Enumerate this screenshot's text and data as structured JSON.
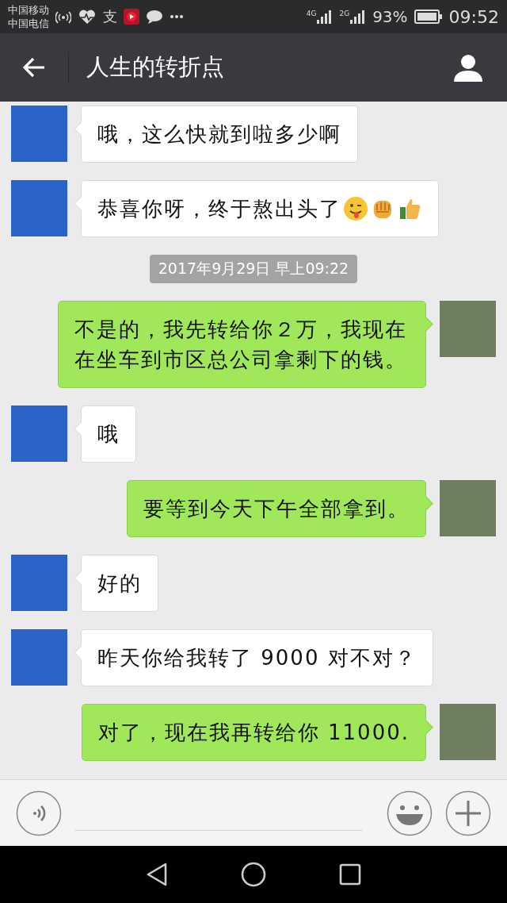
{
  "status_bar": {
    "carriers": [
      "中国移动",
      "中国电信"
    ],
    "app_glyph": "支",
    "signals": [
      {
        "label": "4G"
      },
      {
        "label": "2G"
      }
    ],
    "battery": "93%",
    "time": "09:52"
  },
  "header": {
    "title": "人生的转折点"
  },
  "messages": [
    {
      "kind": "received",
      "text": "哦，这么快就到啦多少啊"
    },
    {
      "kind": "received",
      "text": "恭喜你呀，终于熬出头了",
      "emojis": [
        {
          "kind": "wink"
        },
        {
          "kind": "fist"
        },
        {
          "kind": "thumbs_up"
        }
      ]
    },
    {
      "kind": "timestamp",
      "text": "2017年9月29日 早上09:22"
    },
    {
      "kind": "sent",
      "text": "不是的，我先转给你２万，我现在在坐车到市区总公司拿剩下的钱。"
    },
    {
      "kind": "received",
      "text": "哦"
    },
    {
      "kind": "sent",
      "text": "要等到今天下午全部拿到。"
    },
    {
      "kind": "received",
      "text": "好的"
    },
    {
      "kind": "received",
      "text": "昨天你给我转了 9000 对不对？"
    },
    {
      "kind": "sent",
      "text": "对了，现在我再转给你 11000."
    }
  ]
}
